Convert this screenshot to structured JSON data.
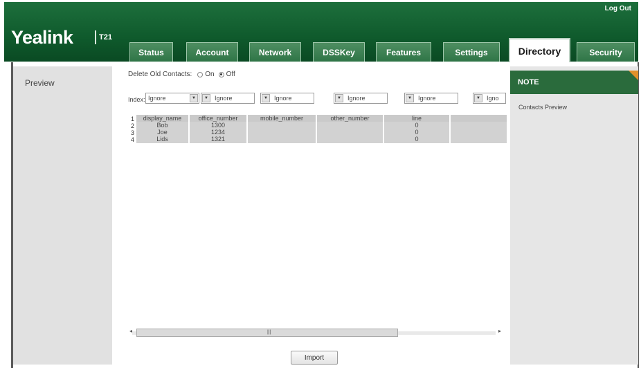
{
  "header": {
    "brand": "Yealink",
    "model": "T21",
    "logout_label": "Log Out"
  },
  "tabs": [
    {
      "label": "Status"
    },
    {
      "label": "Account"
    },
    {
      "label": "Network"
    },
    {
      "label": "DSSKey"
    },
    {
      "label": "Features"
    },
    {
      "label": "Settings"
    },
    {
      "label": "Directory",
      "active": true
    },
    {
      "label": "Security"
    }
  ],
  "sidebar": {
    "items": [
      {
        "label": "Preview"
      }
    ]
  },
  "main": {
    "delete_old": {
      "label": "Delete Old Contacts:",
      "option_on": "On",
      "option_off": "Off",
      "selected": "Off"
    },
    "index_label": "Index:",
    "selectors": [
      "Ignore",
      "Ignore",
      "Ignore",
      "Ignore",
      "Ignore",
      "Igno"
    ],
    "row_numbers": [
      "1",
      "2",
      "3",
      "4"
    ],
    "table": {
      "headers": [
        "display_name",
        "office_number",
        "mobile_number",
        "other_number",
        "line"
      ],
      "rows": [
        [
          "Bob",
          "1300",
          "",
          "",
          "0"
        ],
        [
          "Joe",
          "1234",
          "",
          "",
          "0"
        ],
        [
          "Lids",
          "1321",
          "",
          "",
          "0"
        ]
      ]
    },
    "import_label": "Import"
  },
  "note": {
    "title": "NOTE",
    "text": "Contacts Preview"
  },
  "colors": {
    "header_green": "#0f5a2c",
    "note_green": "#2a6b3c",
    "accent_orange": "#e0902a"
  }
}
